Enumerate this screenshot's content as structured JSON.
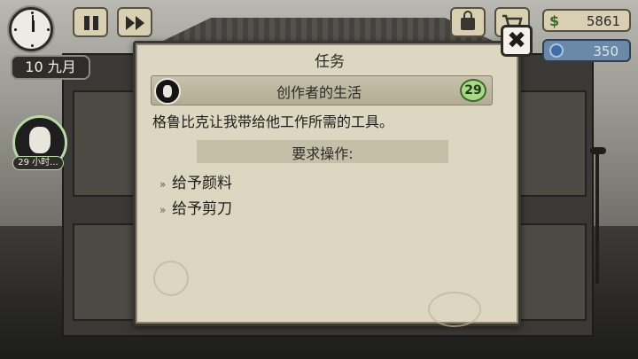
{
  "hud": {
    "date": "10 九月",
    "money": "5861",
    "money_symbol": "$",
    "gems": "350",
    "npc_timer": "29 小时..."
  },
  "dialog": {
    "title": "任务",
    "close_label": "✖",
    "quest": {
      "name": "创作者的生活",
      "hours": "29",
      "description": "格鲁比克让我带给他工作所需的工具。"
    },
    "requirements": {
      "title": "要求操作:",
      "items": [
        "给予颜料",
        "给予剪刀"
      ]
    }
  },
  "colors": {
    "dialog_bg": "#ddd6c0",
    "hours_badge": "#a8d88a",
    "money_text": "#3b6a2a",
    "gems_bg": "#6a88a8"
  },
  "icons": [
    "clock-icon",
    "pause-icon",
    "fast-forward-icon",
    "shop-bag-icon",
    "cart-icon",
    "coin-icon",
    "gem-icon",
    "npc-avatar-icon",
    "close-icon",
    "quest-portrait-icon",
    "bullet-icon"
  ]
}
